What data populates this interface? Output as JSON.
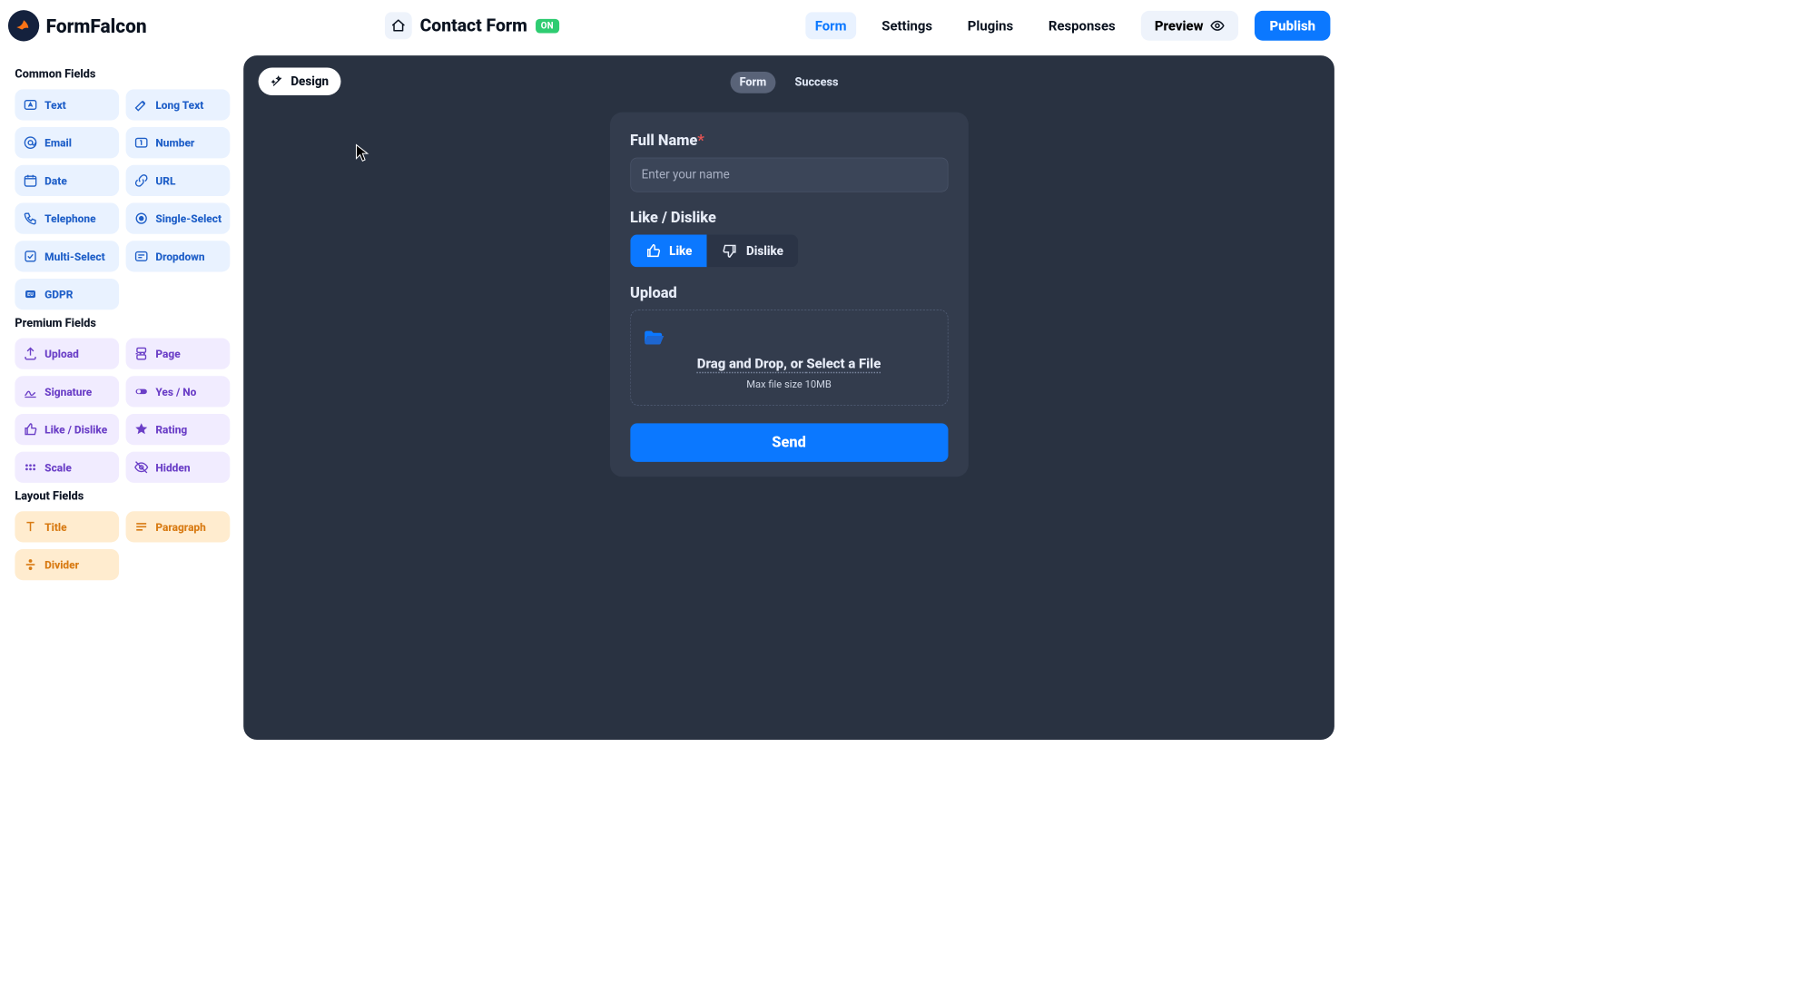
{
  "brand": {
    "name": "FormFalcon"
  },
  "header": {
    "title": "Contact Form",
    "status_badge": "ON",
    "nav": {
      "form": "Form",
      "settings": "Settings",
      "plugins": "Plugins",
      "responses": "Responses"
    },
    "preview_label": "Preview",
    "publish_label": "Publish"
  },
  "sidebar": {
    "sections": {
      "common": "Common Fields",
      "premium": "Premium Fields",
      "layout": "Layout Fields"
    },
    "common": {
      "text": "Text",
      "long_text": "Long Text",
      "email": "Email",
      "number": "Number",
      "date": "Date",
      "url": "URL",
      "telephone": "Telephone",
      "single_select": "Single-Select",
      "multi_select": "Multi-Select",
      "dropdown": "Dropdown",
      "gdpr": "GDPR"
    },
    "premium": {
      "upload": "Upload",
      "page": "Page",
      "signature": "Signature",
      "yes_no": "Yes / No",
      "like_dislike": "Like / Dislike",
      "rating": "Rating",
      "scale": "Scale",
      "hidden": "Hidden"
    },
    "layout": {
      "title": "Title",
      "paragraph": "Paragraph",
      "divider": "Divider"
    }
  },
  "canvas": {
    "design_label": "Design",
    "segment": {
      "form": "Form",
      "success": "Success"
    },
    "fields": {
      "full_name": {
        "label": "Full Name",
        "placeholder": "Enter your name"
      },
      "like_dislike": {
        "label": "Like / Dislike",
        "like": "Like",
        "dislike": "Dislike"
      },
      "upload": {
        "label": "Upload",
        "drop_title_prefix": "Drag and Drop, or ",
        "drop_title_action": "Select a File",
        "drop_sub": "Max file size 10MB"
      },
      "submit": "Send"
    }
  }
}
